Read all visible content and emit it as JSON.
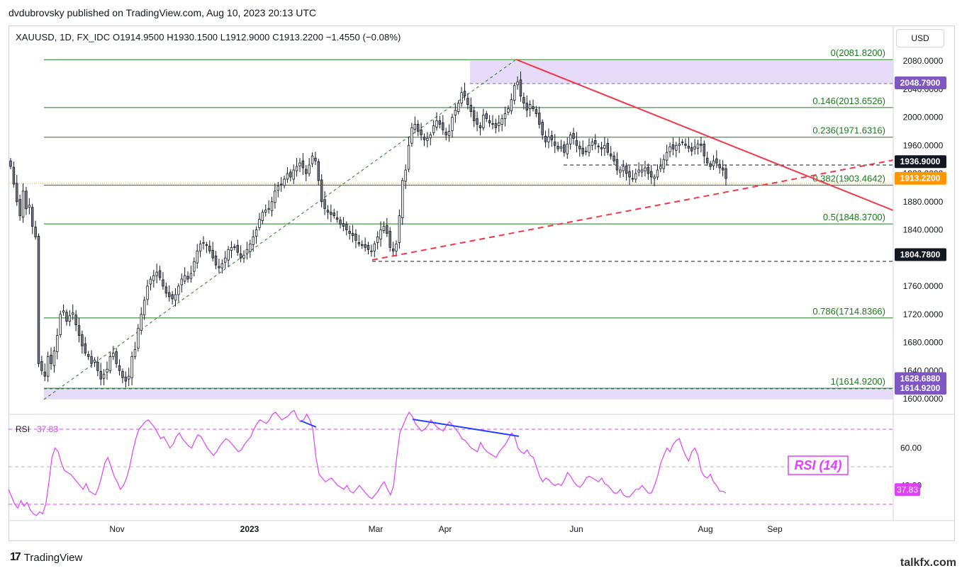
{
  "publisher": "dvdubrovsky published on TradingView.com, Aug 10, 2023 20:13 UTC",
  "legend": "XAUUSD, 1D, FX_IDC  O1914.9500  H1930.1500  L1912.9000  C1913.2200  −1.4550 (−0.08%)",
  "currency_button": "USD",
  "brand": "TradingView",
  "watermark": "talkfx.com",
  "colors": {
    "up": "#131722",
    "down": "#787b86",
    "fib": "#1b7a1b",
    "trend": "#f23645",
    "zone": "#e6dcfa",
    "rsi": "#e040fb",
    "rsi_div": "#2040ff",
    "last": "#ff9800"
  },
  "chart_data": {
    "type": "candlestick",
    "symbol": "XAUUSD",
    "timeframe": "1D",
    "y_axis": {
      "min": 1600,
      "max": 2080,
      "ticks": [
        "2080.0000",
        "2040.0000",
        "2000.0000",
        "1960.0000",
        "1920.0000",
        "1880.0000",
        "1840.0000",
        "1800.0000",
        "1760.0000",
        "1720.0000",
        "1680.0000",
        "1640.0000",
        "1600.0000"
      ]
    },
    "x_axis_labels": [
      "Nov",
      "2023",
      "Mar",
      "Apr",
      "Jun",
      "Aug",
      "Sep"
    ],
    "fib_levels": [
      {
        "label": "0(2081.8200)",
        "price": 2081.82
      },
      {
        "label": "0.146(2013.6526)",
        "price": 2013.6526
      },
      {
        "label": "0.236(1971.6316)",
        "price": 1971.6316
      },
      {
        "label": "0.382(1903.4642)",
        "price": 1903.4642
      },
      {
        "label": "0.5(1848.3700)",
        "price": 1848.37
      },
      {
        "label": "0.786(1714.8366)",
        "price": 1714.8366
      },
      {
        "label": "1(1614.9200)",
        "price": 1614.92
      }
    ],
    "price_tags": [
      {
        "label": "2048.7900",
        "price": 2048.79,
        "color": "#7e57c2"
      },
      {
        "label": "1936.9000",
        "price": 1936.9,
        "color": "#131722"
      },
      {
        "label": "1913.2200",
        "price": 1913.22,
        "color": "#ff9800"
      },
      {
        "label": "1804.7800",
        "price": 1804.78,
        "color": "#131722"
      },
      {
        "label": "1628.6880",
        "price": 1628.688,
        "color": "#7e57c2"
      },
      {
        "label": "1614.9200",
        "price": 1614.92,
        "color": "#7e57c2"
      }
    ],
    "last_close": 1913.22,
    "rsi": {
      "label": "RSI",
      "value": "37.83",
      "period_label": "RSI (14)",
      "ticks": [
        "60.00",
        "40.00"
      ]
    },
    "closes": [
      1930,
      1905,
      1880,
      1860,
      1895,
      1870,
      1875,
      1845,
      1830,
      1650,
      1640,
      1632,
      1660,
      1650,
      1668,
      1690,
      1720,
      1725,
      1710,
      1718,
      1722,
      1705,
      1690,
      1675,
      1665,
      1660,
      1650,
      1655,
      1640,
      1628,
      1635,
      1642,
      1660,
      1665,
      1650,
      1640,
      1630,
      1625,
      1632,
      1660,
      1670,
      1700,
      1720,
      1740,
      1760,
      1770,
      1775,
      1780,
      1772,
      1760,
      1750,
      1745,
      1742,
      1748,
      1760,
      1770,
      1775,
      1770,
      1778,
      1795,
      1810,
      1820,
      1822,
      1818,
      1810,
      1800,
      1790,
      1786,
      1792,
      1800,
      1812,
      1815,
      1815,
      1808,
      1800,
      1804,
      1812,
      1820,
      1830,
      1840,
      1855,
      1865,
      1868,
      1870,
      1880,
      1895,
      1902,
      1905,
      1912,
      1920,
      1915,
      1925,
      1930,
      1935,
      1928,
      1920,
      1932,
      1945,
      1938,
      1910,
      1880,
      1870,
      1865,
      1862,
      1860,
      1855,
      1848,
      1845,
      1840,
      1835,
      1832,
      1825,
      1820,
      1818,
      1815,
      1812,
      1810,
      1820,
      1830,
      1840,
      1845,
      1835,
      1815,
      1810,
      1820,
      1860,
      1910,
      1925,
      1960,
      1985,
      1990,
      1980,
      1975,
      1968,
      1970,
      1975,
      1988,
      1995,
      1990,
      1982,
      1975,
      1980,
      2000,
      2010,
      2020,
      2035,
      2030,
      2018,
      2008,
      1995,
      1990,
      1985,
      2003,
      1998,
      1992,
      1990,
      1985,
      1992,
      1998,
      2005,
      2012,
      2025,
      2045,
      2050,
      2030,
      2020,
      2010,
      2018,
      2012,
      2005,
      1990,
      1975,
      1965,
      1972,
      1968,
      1960,
      1955,
      1958,
      1950,
      1962,
      1975,
      1970,
      1960,
      1955,
      1948,
      1952,
      1960,
      1965,
      1962,
      1958,
      1955,
      1960,
      1950,
      1945,
      1938,
      1925,
      1925,
      1930,
      1920,
      1915,
      1912,
      1920,
      1925,
      1925,
      1928,
      1920,
      1915,
      1915,
      1925,
      1930,
      1940,
      1950,
      1958,
      1955,
      1960,
      1962,
      1965,
      1960,
      1956,
      1952,
      1958,
      1962,
      1960,
      1945,
      1935,
      1930,
      1938,
      1935,
      1928,
      1925,
      1913
    ],
    "rsi_values": [
      38,
      34,
      30,
      28,
      32,
      29,
      31,
      27,
      25,
      24,
      26,
      25,
      30,
      42,
      55,
      60,
      58,
      52,
      48,
      47,
      46,
      44,
      42,
      40,
      38,
      41,
      37,
      36,
      35,
      39,
      45,
      52,
      55,
      50,
      45,
      42,
      38,
      40,
      44,
      50,
      58,
      65,
      70,
      72,
      74,
      75,
      73,
      71,
      68,
      65,
      66,
      63,
      60,
      62,
      66,
      68,
      65,
      63,
      61,
      60,
      64,
      67,
      66,
      63,
      60,
      58,
      56,
      58,
      61,
      63,
      65,
      64,
      62,
      60,
      58,
      59,
      62,
      64,
      66,
      70,
      73,
      75,
      74,
      73,
      75,
      78,
      79,
      77,
      75,
      76,
      77,
      79,
      80,
      76,
      74,
      75,
      78,
      75,
      70,
      55,
      46,
      44,
      42,
      43,
      44,
      42,
      40,
      39,
      38,
      40,
      37,
      36,
      38,
      40,
      38,
      36,
      34,
      33,
      35,
      37,
      40,
      42,
      38,
      35,
      40,
      55,
      68,
      72,
      76,
      79,
      77,
      73,
      71,
      69,
      70,
      72,
      75,
      73,
      71,
      70,
      69,
      72,
      74,
      72,
      70,
      68,
      65,
      64,
      62,
      60,
      59,
      58,
      63,
      60,
      58,
      57,
      56,
      55,
      58,
      60,
      62,
      65,
      68,
      66,
      60,
      58,
      57,
      59,
      56,
      55,
      50,
      45,
      42,
      44,
      43,
      41,
      40,
      41,
      40,
      43,
      47,
      45,
      42,
      40,
      39,
      41,
      44,
      45,
      44,
      43,
      42,
      44,
      41,
      40,
      38,
      36,
      36,
      38,
      35,
      34,
      34,
      36,
      38,
      38,
      40,
      38,
      36,
      36,
      40,
      45,
      52,
      56,
      60,
      58,
      62,
      64,
      65,
      60,
      56,
      53,
      58,
      60,
      56,
      48,
      45,
      44,
      46,
      42,
      40,
      37,
      37,
      36
    ]
  }
}
